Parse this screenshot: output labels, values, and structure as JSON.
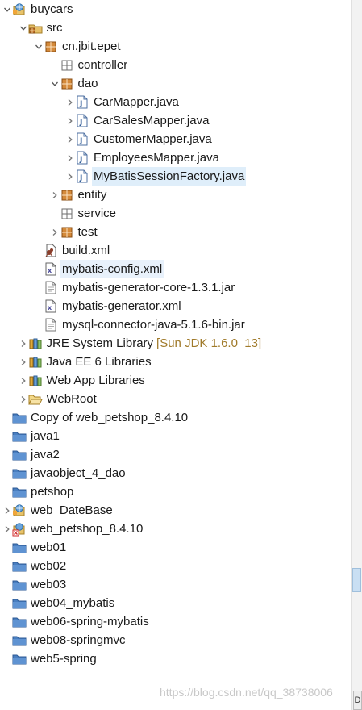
{
  "tree": {
    "rows": [
      {
        "label": "buycars",
        "icon": "web-project-icon",
        "expander": "open",
        "indent": 0
      },
      {
        "label": "src",
        "icon": "source-folder-icon",
        "expander": "open",
        "indent": 1
      },
      {
        "label": "cn.jbit.epet",
        "icon": "package-icon",
        "expander": "open",
        "indent": 2
      },
      {
        "label": "controller",
        "icon": "package-empty-icon",
        "expander": "none",
        "indent": 3
      },
      {
        "label": "dao",
        "icon": "package-icon",
        "expander": "open",
        "indent": 3
      },
      {
        "label": "CarMapper.java",
        "icon": "java-file-icon",
        "expander": "closed",
        "indent": 4
      },
      {
        "label": "CarSalesMapper.java",
        "icon": "java-file-icon",
        "expander": "closed",
        "indent": 4
      },
      {
        "label": "CustomerMapper.java",
        "icon": "java-file-icon",
        "expander": "closed",
        "indent": 4
      },
      {
        "label": "EmployeesMapper.java",
        "icon": "java-file-icon",
        "expander": "closed",
        "indent": 4
      },
      {
        "label": "MyBatisSessionFactory.java",
        "icon": "java-file-icon",
        "expander": "closed",
        "indent": 4,
        "selected": true
      },
      {
        "label": "entity",
        "icon": "package-icon",
        "expander": "closed",
        "indent": 3
      },
      {
        "label": "service",
        "icon": "package-empty-icon",
        "expander": "none",
        "indent": 3
      },
      {
        "label": "test",
        "icon": "package-icon",
        "expander": "closed",
        "indent": 3
      },
      {
        "label": "build.xml",
        "icon": "ant-build-icon",
        "expander": "none",
        "indent": 2
      },
      {
        "label": "mybatis-config.xml",
        "icon": "xml-file-icon",
        "expander": "none",
        "indent": 2,
        "hover": true
      },
      {
        "label": "mybatis-generator-core-1.3.1.jar",
        "icon": "jar-file-icon",
        "expander": "none",
        "indent": 2
      },
      {
        "label": "mybatis-generator.xml",
        "icon": "xml-file-icon",
        "expander": "none",
        "indent": 2
      },
      {
        "label": "mysql-connector-java-5.1.6-bin.jar",
        "icon": "jar-file-icon",
        "expander": "none",
        "indent": 2
      },
      {
        "label": "JRE System Library",
        "decoration": "[Sun JDK 1.6.0_13]",
        "icon": "library-icon",
        "expander": "closed",
        "indent": 1
      },
      {
        "label": "Java EE 6 Libraries",
        "icon": "library-icon",
        "expander": "closed",
        "indent": 1
      },
      {
        "label": "Web App Libraries",
        "icon": "library-icon",
        "expander": "closed",
        "indent": 1
      },
      {
        "label": "WebRoot",
        "icon": "open-folder-icon",
        "expander": "closed",
        "indent": 1
      },
      {
        "label": "Copy of web_petshop_8.4.10",
        "icon": "project-folder-icon",
        "expander": "none",
        "indent": 0
      },
      {
        "label": "java1",
        "icon": "project-folder-icon",
        "expander": "none",
        "indent": 0
      },
      {
        "label": "java2",
        "icon": "project-folder-icon",
        "expander": "none",
        "indent": 0
      },
      {
        "label": "javaobject_4_dao",
        "icon": "project-folder-icon",
        "expander": "none",
        "indent": 0
      },
      {
        "label": "petshop",
        "icon": "project-folder-icon",
        "expander": "none",
        "indent": 0
      },
      {
        "label": "web_DateBase",
        "icon": "web-project-icon",
        "expander": "closed",
        "indent": 0
      },
      {
        "label": "web_petshop_8.4.10",
        "icon": "web-project-error-icon",
        "expander": "closed",
        "indent": 0
      },
      {
        "label": "web01",
        "icon": "project-folder-icon",
        "expander": "none",
        "indent": 0
      },
      {
        "label": "web02",
        "icon": "project-folder-icon",
        "expander": "none",
        "indent": 0
      },
      {
        "label": "web03",
        "icon": "project-folder-icon",
        "expander": "none",
        "indent": 0
      },
      {
        "label": "web04_mybatis",
        "icon": "project-folder-icon",
        "expander": "none",
        "indent": 0
      },
      {
        "label": "web06-spring-mybatis",
        "icon": "project-folder-icon",
        "expander": "none",
        "indent": 0
      },
      {
        "label": "web08-springmvc",
        "icon": "project-folder-icon",
        "expander": "none",
        "indent": 0
      },
      {
        "label": "web5-spring",
        "icon": "project-folder-icon",
        "expander": "none",
        "indent": 0
      }
    ]
  },
  "watermark": "https://blog.csdn.net/qq_38738006",
  "corner_label": "D",
  "colors": {
    "selected": "#dfeefa",
    "decoration": "#a07a2a",
    "folder": "#4a7fc0",
    "package": "#b5651d"
  }
}
